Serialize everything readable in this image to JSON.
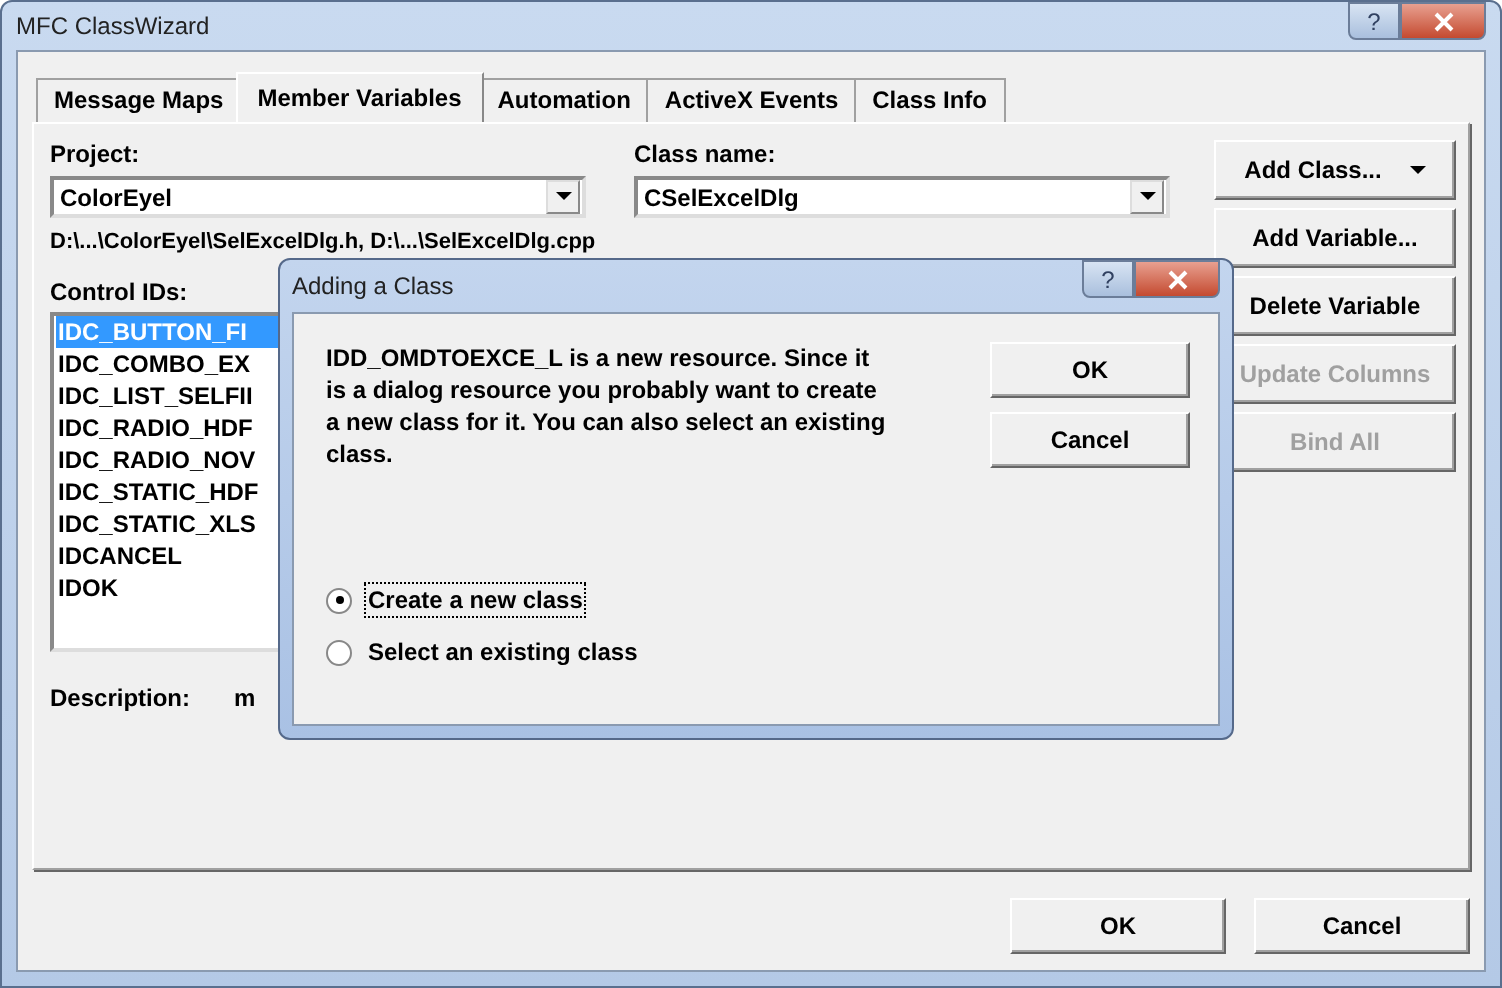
{
  "window": {
    "title": "MFC ClassWizard",
    "help_button": "?"
  },
  "tabs": [
    {
      "label": "Message Maps",
      "selected": false
    },
    {
      "label": "Member Variables",
      "selected": true
    },
    {
      "label": "Automation",
      "selected": false
    },
    {
      "label": "ActiveX Events",
      "selected": false
    },
    {
      "label": "Class Info",
      "selected": false
    }
  ],
  "project": {
    "label": "Project:",
    "value": "ColorEyel"
  },
  "class_name": {
    "label": "Class name:",
    "value": "CSelExcelDlg"
  },
  "path": "D:\\...\\ColorEyel\\SelExcelDlg.h, D:\\...\\SelExcelDlg.cpp",
  "control_ids": {
    "label": "Control IDs:",
    "items": [
      {
        "text": "IDC_BUTTON_FI",
        "selected": true
      },
      {
        "text": "IDC_COMBO_EX",
        "selected": false
      },
      {
        "text": "IDC_LIST_SELFII",
        "selected": false
      },
      {
        "text": "IDC_RADIO_HDF",
        "selected": false
      },
      {
        "text": "IDC_RADIO_NOV",
        "selected": false
      },
      {
        "text": "IDC_STATIC_HDF",
        "selected": false
      },
      {
        "text": "IDC_STATIC_XLS",
        "selected": false
      },
      {
        "text": "IDCANCEL",
        "selected": false
      },
      {
        "text": "IDOK",
        "selected": false
      }
    ]
  },
  "description": {
    "label": "Description:",
    "value": "m"
  },
  "side_buttons": [
    {
      "label": "Add Class...",
      "disabled": false,
      "dropdown": true
    },
    {
      "label": "Add Variable...",
      "disabled": false,
      "dropdown": false
    },
    {
      "label": "Delete Variable",
      "disabled": false,
      "dropdown": false
    },
    {
      "label": "Update Columns",
      "disabled": true,
      "dropdown": false
    },
    {
      "label": "Bind All",
      "disabled": true,
      "dropdown": false
    }
  ],
  "buttons": [
    "OK",
    "Cancel"
  ],
  "dialog": {
    "title": "Adding a Class",
    "help_button": "?",
    "message": "IDD_OMDTOEXCE_L is a new resource.  Since it is a dialog resource you probably want to create a new class for it.  You can also select an existing class.",
    "buttons": [
      "OK",
      "Cancel"
    ],
    "options": [
      {
        "label": "Create a new class",
        "selected": true
      },
      {
        "label": "Select an existing class",
        "selected": false
      }
    ]
  }
}
